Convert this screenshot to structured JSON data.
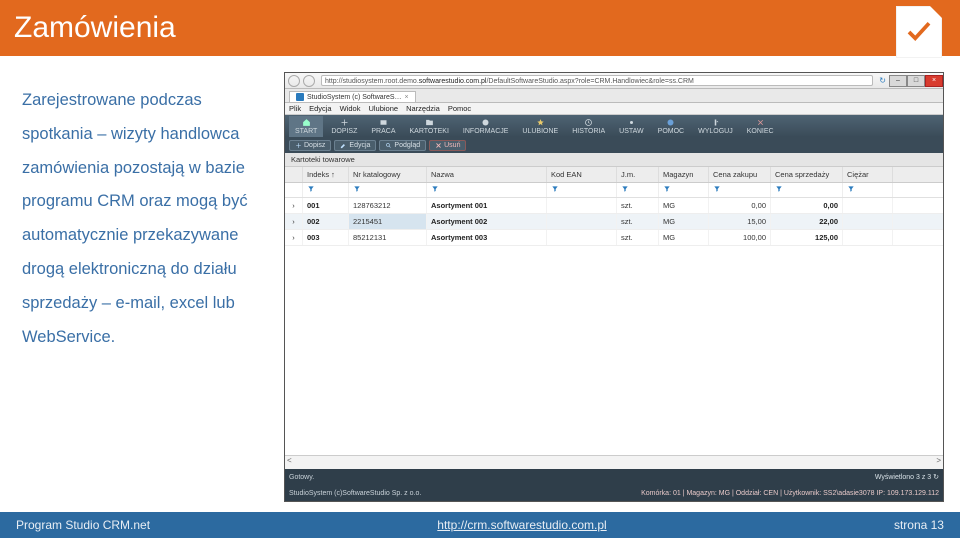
{
  "slide": {
    "title": "Zamówienia",
    "body_text": "Zarejestrowane podczas spotkania – wizyty handlowca zamówienia pozostają w bazie programu CRM oraz mogą być automatycznie przekazywane drogą elektroniczną do działu sprzedaży – e-mail, excel lub WebService."
  },
  "browser": {
    "url_prefix": "http://studiosystem.root.demo.",
    "url_bold": "softwarestudio.com.pl",
    "url_suffix": "/DefaultSoftwareStudio.aspx?role=CRM.Handlowiec&role=ss.CRM",
    "tab_label": "StudioSystem (c) SoftwareS…"
  },
  "app": {
    "menu": [
      "Plik",
      "Edycja",
      "Widok",
      "Ulubione",
      "Narzędzia",
      "Pomoc"
    ],
    "ribbon": [
      "START",
      "DOPISZ",
      "PRACA",
      "KARTOTEKI",
      "INFORMACJE",
      "ULUBIONE",
      "HISTORIA",
      "USTAW",
      "POMOC",
      "WYLOGUJ",
      "KONIEC"
    ],
    "toolbar": {
      "add": "Dopisz",
      "edit": "Edycja",
      "view": "Podgląd",
      "del": "Usuń"
    },
    "subheader": "Kartoteki towarowe",
    "grid": {
      "columns": [
        "Indeks",
        "Nr katalogowy",
        "Nazwa",
        "Kod EAN",
        "J.m.",
        "Magazyn",
        "Cena zakupu",
        "Cena sprzedaży",
        "Ciężar"
      ],
      "rows": [
        {
          "indeks": "001",
          "kat": "128763212",
          "nazwa": "Asortyment 001",
          "ean": "",
          "jm": "szt.",
          "mag": "MG",
          "cz": "0,00",
          "cs": "0,00",
          "ci": ""
        },
        {
          "indeks": "002",
          "kat": "2215451",
          "nazwa": "Asortyment 002",
          "ean": "",
          "jm": "szt.",
          "mag": "MG",
          "cz": "15,00",
          "cs": "22,00",
          "ci": "",
          "selected": true
        },
        {
          "indeks": "003",
          "kat": "85212131",
          "nazwa": "Asortyment 003",
          "ean": "",
          "jm": "szt.",
          "mag": "MG",
          "cz": "100,00",
          "cs": "125,00",
          "ci": ""
        }
      ]
    },
    "status": {
      "left": "Gotowy.",
      "count": "Wyświetlono 3 z 3",
      "vendor": "StudioSystem (c)SoftwareStudio Sp. z o.o.",
      "right": "Komórka: 01 | Magazyn: MG | Oddział: CEN | Użytkownik: SS2\\adasie3078 IP: 109.173.129.112"
    }
  },
  "footer": {
    "left": "Program Studio CRM.net",
    "link": "http://crm.softwarestudio.com.pl",
    "right": "strona 13"
  }
}
